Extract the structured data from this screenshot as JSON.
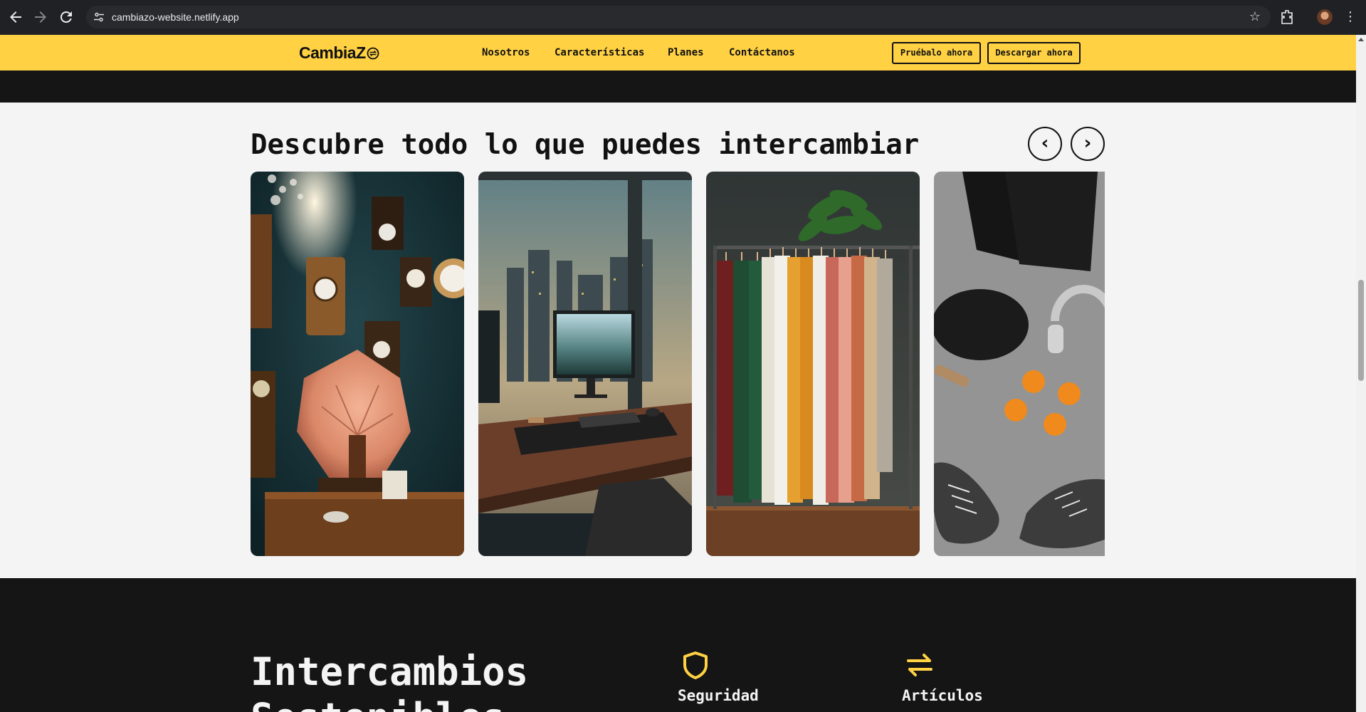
{
  "browser": {
    "url": "cambiazo-website.netlify.app",
    "back_icon": "arrow-back-icon",
    "forward_icon": "arrow-forward-icon",
    "reload_icon": "reload-icon"
  },
  "header": {
    "logo": "CambiaZ",
    "nav": [
      "Nosotros",
      "Características",
      "Planes",
      "Contáctanos"
    ],
    "try_button": "Pruébalo ahora",
    "download_button": "Descargar ahora",
    "accent_color": "#ffd143"
  },
  "carousel": {
    "title": "Descubre todo lo que puedes intercambiar",
    "prev_symbol": "‹",
    "next_symbol": "›",
    "cards": [
      {
        "subject": "antiques-gramophone-clocks"
      },
      {
        "subject": "computer-desk-city-view"
      },
      {
        "subject": "clothing-rack-tshirts"
      },
      {
        "subject": "sports-items-sneakers"
      }
    ]
  },
  "features": {
    "heading": "Intercambios Sostenibles",
    "items": [
      {
        "label": "Seguridad",
        "icon": "shield-icon"
      },
      {
        "label": "Artículos",
        "icon": "swap-arrows-icon"
      }
    ]
  }
}
